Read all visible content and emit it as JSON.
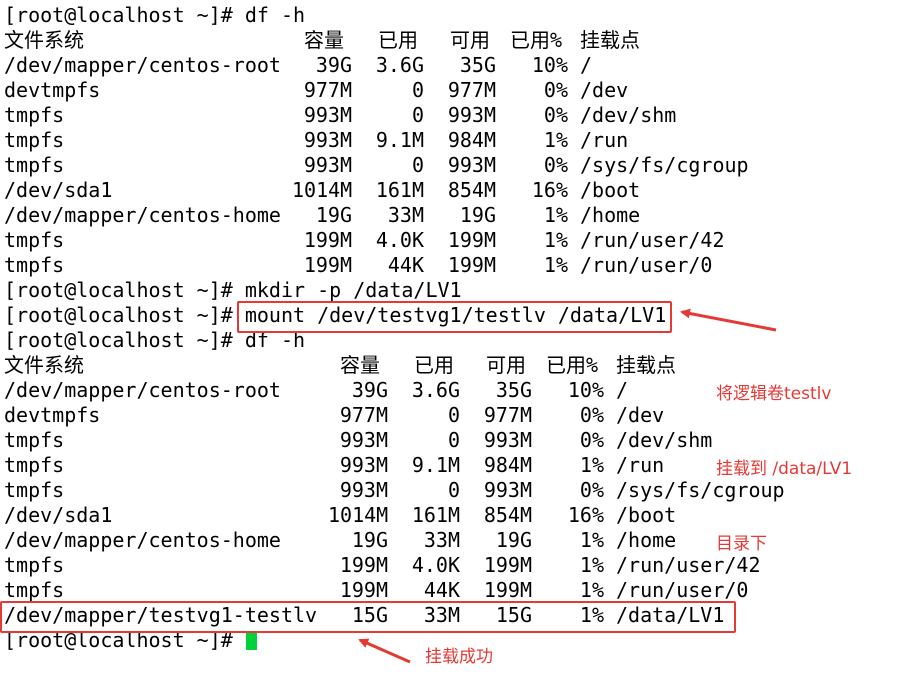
{
  "session": {
    "prompt": "[root@localhost ~]# ",
    "cmd_df1": "df -h",
    "cmd_mkdir": "mkdir -p /data/LV1",
    "cmd_mount": "mount /dev/testvg1/testlv /data/LV1",
    "cmd_df2": "df -h"
  },
  "columns": [
    "文件系统",
    "容量",
    "已用",
    "可用",
    "已用%",
    "挂载点"
  ],
  "df1_rows": [
    [
      "/dev/mapper/centos-root",
      "39G",
      "3.6G",
      "35G",
      "10%",
      "/"
    ],
    [
      "devtmpfs",
      "977M",
      "0",
      "977M",
      "0%",
      "/dev"
    ],
    [
      "tmpfs",
      "993M",
      "0",
      "993M",
      "0%",
      "/dev/shm"
    ],
    [
      "tmpfs",
      "993M",
      "9.1M",
      "984M",
      "1%",
      "/run"
    ],
    [
      "tmpfs",
      "993M",
      "0",
      "993M",
      "0%",
      "/sys/fs/cgroup"
    ],
    [
      "/dev/sda1",
      "1014M",
      "161M",
      "854M",
      "16%",
      "/boot"
    ],
    [
      "/dev/mapper/centos-home",
      "19G",
      "33M",
      "19G",
      "1%",
      "/home"
    ],
    [
      "tmpfs",
      "199M",
      "4.0K",
      "199M",
      "1%",
      "/run/user/42"
    ],
    [
      "tmpfs",
      "199M",
      "44K",
      "199M",
      "1%",
      "/run/user/0"
    ]
  ],
  "df2_rows": [
    [
      "/dev/mapper/centos-root",
      "39G",
      "3.6G",
      "35G",
      "10%",
      "/"
    ],
    [
      "devtmpfs",
      "977M",
      "0",
      "977M",
      "0%",
      "/dev"
    ],
    [
      "tmpfs",
      "993M",
      "0",
      "993M",
      "0%",
      "/dev/shm"
    ],
    [
      "tmpfs",
      "993M",
      "9.1M",
      "984M",
      "1%",
      "/run"
    ],
    [
      "tmpfs",
      "993M",
      "0",
      "993M",
      "0%",
      "/sys/fs/cgroup"
    ],
    [
      "/dev/sda1",
      "1014M",
      "161M",
      "854M",
      "16%",
      "/boot"
    ],
    [
      "/dev/mapper/centos-home",
      "19G",
      "33M",
      "19G",
      "1%",
      "/home"
    ],
    [
      "tmpfs",
      "199M",
      "4.0K",
      "199M",
      "1%",
      "/run/user/42"
    ],
    [
      "tmpfs",
      "199M",
      "44K",
      "199M",
      "1%",
      "/run/user/0"
    ],
    [
      "/dev/mapper/testvg1-testlv",
      "15G",
      "33M",
      "15G",
      "1%",
      "/data/LV1"
    ]
  ],
  "annotations": {
    "mount_note_line1": "将逻辑卷testlv",
    "mount_note_line2": "挂载到 /data/LV1",
    "mount_note_line3": "目录下",
    "success_note": "挂载成功"
  },
  "colors": {
    "annotation": "#e53935",
    "cursor": "#00d23c",
    "text": "#000000",
    "background": "#ffffff"
  }
}
